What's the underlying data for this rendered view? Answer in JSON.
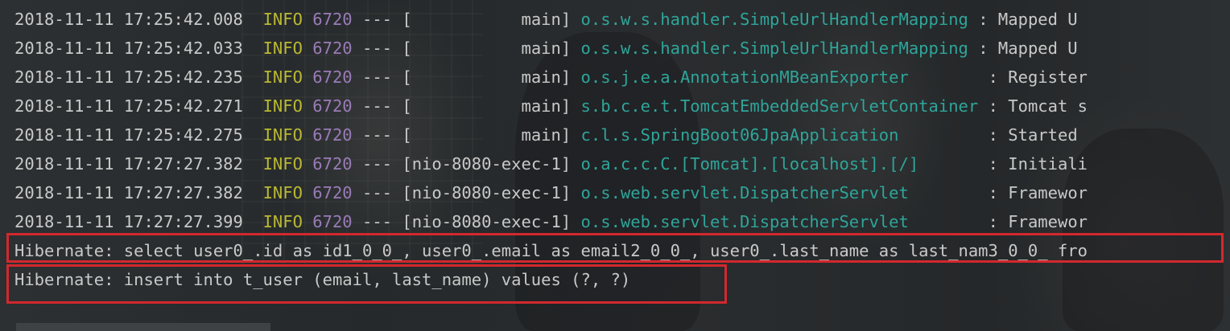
{
  "console": {
    "log_lines": [
      {
        "timestamp": "2018-11-11 17:25:42.008",
        "level": "INFO",
        "pid": "6720",
        "separator": "---",
        "thread": "[           main]",
        "logger": "o.s.w.s.handler.SimpleUrlHandlerMapping",
        "message": " : Mapped U"
      },
      {
        "timestamp": "2018-11-11 17:25:42.033",
        "level": "INFO",
        "pid": "6720",
        "separator": "---",
        "thread": "[           main]",
        "logger": "o.s.w.s.handler.SimpleUrlHandlerMapping",
        "message": " : Mapped U"
      },
      {
        "timestamp": "2018-11-11 17:25:42.235",
        "level": "INFO",
        "pid": "6720",
        "separator": "---",
        "thread": "[           main]",
        "logger": "o.s.j.e.a.AnnotationMBeanExporter       ",
        "message": " : Register"
      },
      {
        "timestamp": "2018-11-11 17:25:42.271",
        "level": "INFO",
        "pid": "6720",
        "separator": "---",
        "thread": "[           main]",
        "logger": "s.b.c.e.t.TomcatEmbeddedServletContainer",
        "message": " : Tomcat s"
      },
      {
        "timestamp": "2018-11-11 17:25:42.275",
        "level": "INFO",
        "pid": "6720",
        "separator": "---",
        "thread": "[           main]",
        "logger": "c.l.s.SpringBoot06JpaApplication        ",
        "message": " : Started "
      },
      {
        "timestamp": "2018-11-11 17:27:27.382",
        "level": "INFO",
        "pid": "6720",
        "separator": "---",
        "thread": "[nio-8080-exec-1]",
        "logger": "o.a.c.c.C.[Tomcat].[localhost].[/]      ",
        "message": " : Initiali"
      },
      {
        "timestamp": "2018-11-11 17:27:27.382",
        "level": "INFO",
        "pid": "6720",
        "separator": "---",
        "thread": "[nio-8080-exec-1]",
        "logger": "o.s.web.servlet.DispatcherServlet       ",
        "message": " : Framewor"
      },
      {
        "timestamp": "2018-11-11 17:27:27.399",
        "level": "INFO",
        "pid": "6720",
        "separator": "---",
        "thread": "[nio-8080-exec-1]",
        "logger": "o.s.web.servlet.DispatcherServlet       ",
        "message": " : Framewor"
      }
    ],
    "hibernate_lines": [
      "Hibernate: select user0_.id as id1_0_0_, user0_.email as email2_0_0_, user0_.last_name as last_nam3_0_0_ fro",
      "Hibernate: insert into t_user (email, last_name) values (?, ?)"
    ]
  },
  "colors": {
    "timestamp": "#c9c9c9",
    "level": "#b9b833",
    "pid": "#9a7bb8",
    "logger": "#2ea59a",
    "highlight_border": "#d2282e",
    "background": "#262a2c"
  }
}
